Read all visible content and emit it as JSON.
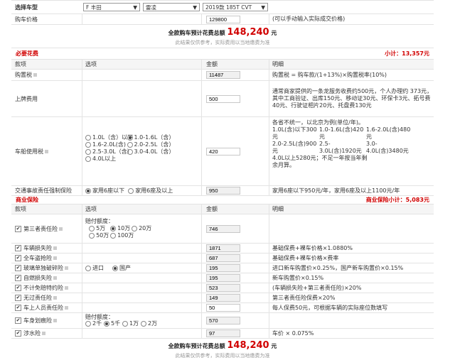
{
  "selector": {
    "label": "选择车型",
    "brand": "F 丰田",
    "series": "雷凌",
    "model": "2019款 185T CVT"
  },
  "price": {
    "label": "购车价格",
    "value": "129800",
    "hint": "(可以手动输入实际成交价格)"
  },
  "summary": {
    "label": "全款购车预计花费总额",
    "amount": "148,240",
    "unit": "元",
    "note": "此结果仅供参考，实际费用以当地缴费为准"
  },
  "required": {
    "title": "必要花费",
    "subtotal": "小计：13,357元",
    "headers": [
      "款项",
      "选项",
      "金额",
      "明细"
    ],
    "purchase_tax": {
      "name": "购置税",
      "value": "11487",
      "detail": "购置税 = 购车款/(1+13%)×购置税率(10%)"
    },
    "registration": {
      "name": "上牌费用",
      "value": "500",
      "detail": "通常商家提供的一条龙服务收费约500元，个人办理约 373元，其中工商验证、出库150元、移动证30元、环保卡3元、拓号费40元、行驶证相片20元、托盘费130元"
    },
    "vehicle_tax": {
      "name": "车船使用税",
      "options": [
        "1.0L（含）以下",
        "1.0-1.6L（含）",
        "1.6-2.0L(含)",
        "2.0-2.5L（含）",
        "2.5-3.0L（含）",
        "3.0-4.0L（含）",
        "4.0L以上"
      ],
      "value": "420",
      "detail_intro": "各省不统一，以北京为例(单位/年)。",
      "detail_items": [
        "1.0L(含)以下300元",
        "1.0-1.6L(含)420元",
        "1.6-2.0L(含)480元",
        "2.0-2.5L(含)900元",
        "2.5-3.0L(含)1920元",
        "3.0-4.0L(含)3480元"
      ],
      "detail_tail": "4.0L以上5280元；不足一年按当年剩余月算。"
    },
    "compulsory": {
      "name": "交通事故责任强制保险",
      "options": [
        "家用6座以下",
        "家用6座及以上"
      ],
      "value": "950",
      "detail": "家用6座以下950元/年，家用6座及以上1100元/年"
    }
  },
  "commercial": {
    "title": "商业保险",
    "subtotal": "商业保险小计：5,083元",
    "headers": [
      "款项",
      "选项",
      "金额",
      "明细"
    ],
    "third_party": {
      "name": "第三者责任险",
      "caption": "赔付额度：",
      "options": [
        "5万",
        "10万",
        "20万",
        "50万",
        "100万"
      ],
      "value": "746"
    },
    "damage": {
      "name": "车辆损失险",
      "value": "1871",
      "detail": "基础保费+裸车价格×1.0880%"
    },
    "theft": {
      "name": "全车盗抢险",
      "value": "687",
      "detail": "基础保费+裸车价格×费率"
    },
    "glass": {
      "name": "玻璃单独破碎险",
      "options": [
        "进口",
        "国产"
      ],
      "value": "195",
      "detail": "进口新车购置价×0.25%，国产新车购置价×0.15%"
    },
    "fire": {
      "name": "自燃损失险",
      "value": "195",
      "detail": "新车购置价×0.15%"
    },
    "deductible": {
      "name": "不计免赔特约险",
      "value": "523",
      "detail": "(车辆损失险+第三者责任险)×20%"
    },
    "no_fault": {
      "name": "无过责任险",
      "value": "149",
      "detail": "第三者责任险保费×20%"
    },
    "passenger": {
      "name": "车上人员责任险",
      "value": "50",
      "detail": "每人保费50元，可根据车辆的实际座位数填写"
    },
    "scratch": {
      "name": "车身划痕险",
      "caption": "赔付额度：",
      "options": [
        "2千",
        "5千",
        "1万",
        "2万"
      ],
      "value": "570"
    },
    "wading": {
      "name": "涉水险",
      "value": "97",
      "detail": "车价 × 0.075%"
    }
  },
  "summary2": {
    "label": "全款购车预计花费总额",
    "amount": "148,240",
    "unit": "元",
    "note": "此结果仅供参考，实际费用以当地缴费为准"
  }
}
